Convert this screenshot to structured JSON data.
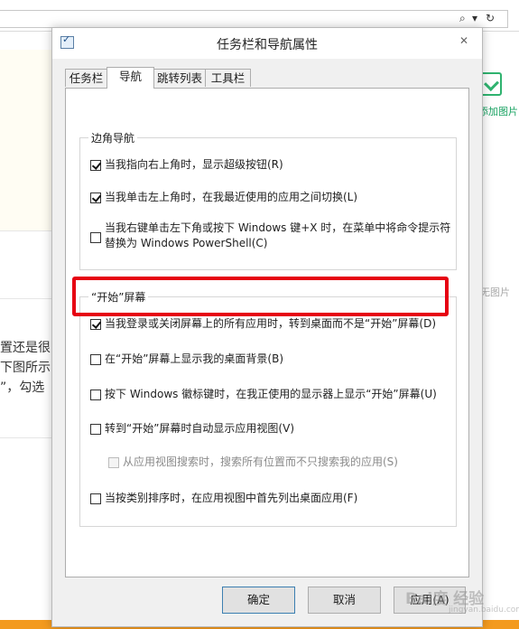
{
  "background": {
    "left_text_lines": [
      "置还是很",
      "下图所示",
      "”，勾选"
    ],
    "right_label": "添加图片",
    "no_image_label": "无图片",
    "watermark": "Bai度 经验",
    "watermark_sub": "jingyan.baidu.com"
  },
  "dialog": {
    "title": "任务栏和导航属性",
    "close_glyph": "✕",
    "tabs": [
      {
        "label": "任务栏",
        "active": false
      },
      {
        "label": "导航",
        "active": true
      },
      {
        "label": "跳转列表",
        "active": false
      },
      {
        "label": "工具栏",
        "active": false
      }
    ],
    "corner_group": {
      "title": "边角导航",
      "options": [
        {
          "label": "当我指向右上角时，显示超级按钮(R)",
          "checked": true
        },
        {
          "label": "当我单击左上角时，在我最近使用的应用之间切换(L)",
          "checked": true
        },
        {
          "label_line1": "当我右键单击左下角或按下 Windows 键+X 时，在菜单中将命令提示符",
          "label_line2": "替换为 Windows PowerShell(C)",
          "checked": false
        }
      ]
    },
    "start_group": {
      "title": "“开始”屏幕",
      "options": [
        {
          "label": "当我登录或关闭屏幕上的所有应用时，转到桌面而不是“开始”屏幕(D)",
          "checked": true
        },
        {
          "label": "在“开始”屏幕上显示我的桌面背景(B)",
          "checked": false
        },
        {
          "label": "按下 Windows 徽标键时，在我正使用的显示器上显示“开始”屏幕(U)",
          "checked": false
        },
        {
          "label": "转到“开始”屏幕时自动显示应用视图(V)",
          "checked": false
        },
        {
          "label": "从应用视图搜索时，搜索所有位置而不只搜索我的应用(S)",
          "checked": false,
          "disabled": true
        },
        {
          "label": "当按类别排序时，在应用视图中首先列出桌面应用(F)",
          "checked": false
        }
      ]
    },
    "buttons": {
      "ok": "确定",
      "cancel": "取消",
      "apply": "应用(A)"
    }
  },
  "colors": {
    "highlight": "#e60012",
    "accent_green": "#2fb36f",
    "bottom_strip": "#f39a1f"
  }
}
